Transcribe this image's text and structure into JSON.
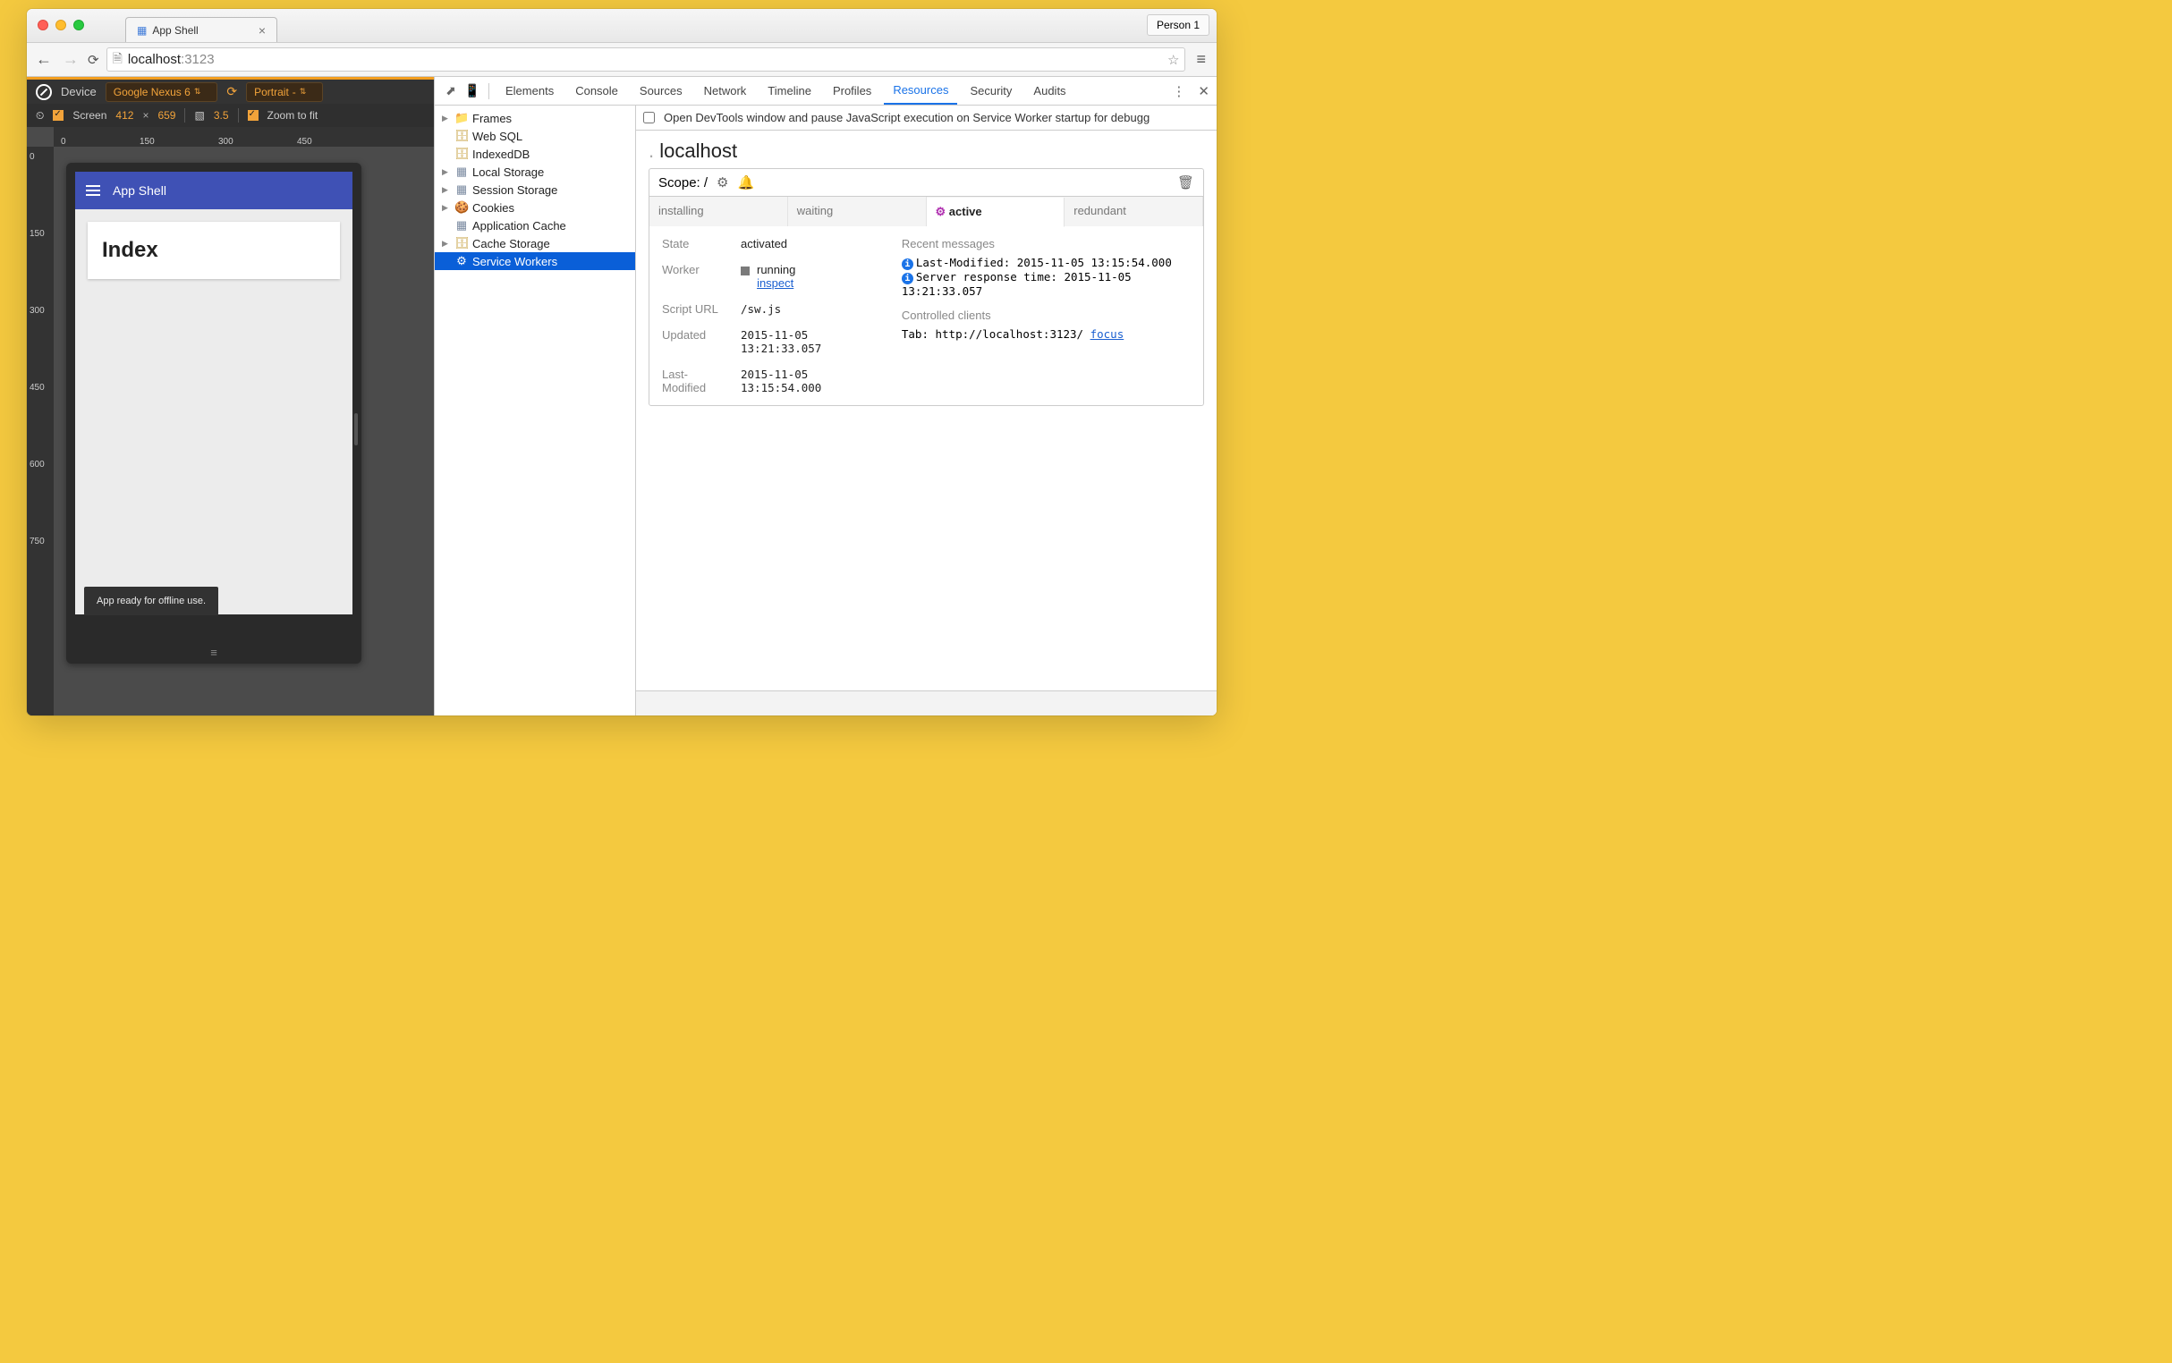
{
  "browser": {
    "tab_title": "App Shell",
    "person_label": "Person 1",
    "url_host": "localhost",
    "url_port": ":3123"
  },
  "device_toolbar": {
    "device_label": "Device",
    "device_value": "Google Nexus 6",
    "orientation": "Portrait",
    "screen_label": "Screen",
    "screen_w": "412",
    "screen_h": "659",
    "dpr": "3.5",
    "zoom_label": "Zoom to fit"
  },
  "ruler_h": [
    "0",
    "150",
    "300",
    "450"
  ],
  "ruler_v": [
    "0",
    "150",
    "300",
    "450",
    "600",
    "750"
  ],
  "app": {
    "header": "App Shell",
    "card_title": "Index",
    "toast": "App ready for offline use."
  },
  "devtools": {
    "tabs": [
      "Elements",
      "Console",
      "Sources",
      "Network",
      "Timeline",
      "Profiles",
      "Resources",
      "Security",
      "Audits"
    ],
    "active_tab": "Resources",
    "pause_label": "Open DevTools window and pause JavaScript execution on Service Worker startup for debugg",
    "tree": {
      "frames": "Frames",
      "websql": "Web SQL",
      "indexeddb": "IndexedDB",
      "localstorage": "Local Storage",
      "sessionstorage": "Session Storage",
      "cookies": "Cookies",
      "appcache": "Application Cache",
      "cachestorage": "Cache Storage",
      "sw": "Service Workers"
    },
    "host_header": "localhost",
    "scope_label": "Scope: /",
    "sw_tabs": {
      "installing": "installing",
      "waiting": "waiting",
      "active": "active",
      "redundant": "redundant"
    },
    "sw": {
      "state_k": "State",
      "state_v": "activated",
      "worker_k": "Worker",
      "worker_v": "running",
      "inspect": "inspect",
      "script_k": "Script URL",
      "script_v": "/sw.js",
      "updated_k": "Updated",
      "updated_v": "2015-11-05 13:21:33.057",
      "lastmod_k": "Last-Modified",
      "lastmod_v": "2015-11-05 13:15:54.000"
    },
    "msgs": {
      "recent": "Recent messages",
      "m1": "Last-Modified: 2015-11-05 13:15:54.000",
      "m2": "Server response time: 2015-11-05 13:21:33.057",
      "clients": "Controlled clients",
      "tab_prefix": "Tab: http://localhost:3123/ ",
      "focus": "focus"
    }
  }
}
